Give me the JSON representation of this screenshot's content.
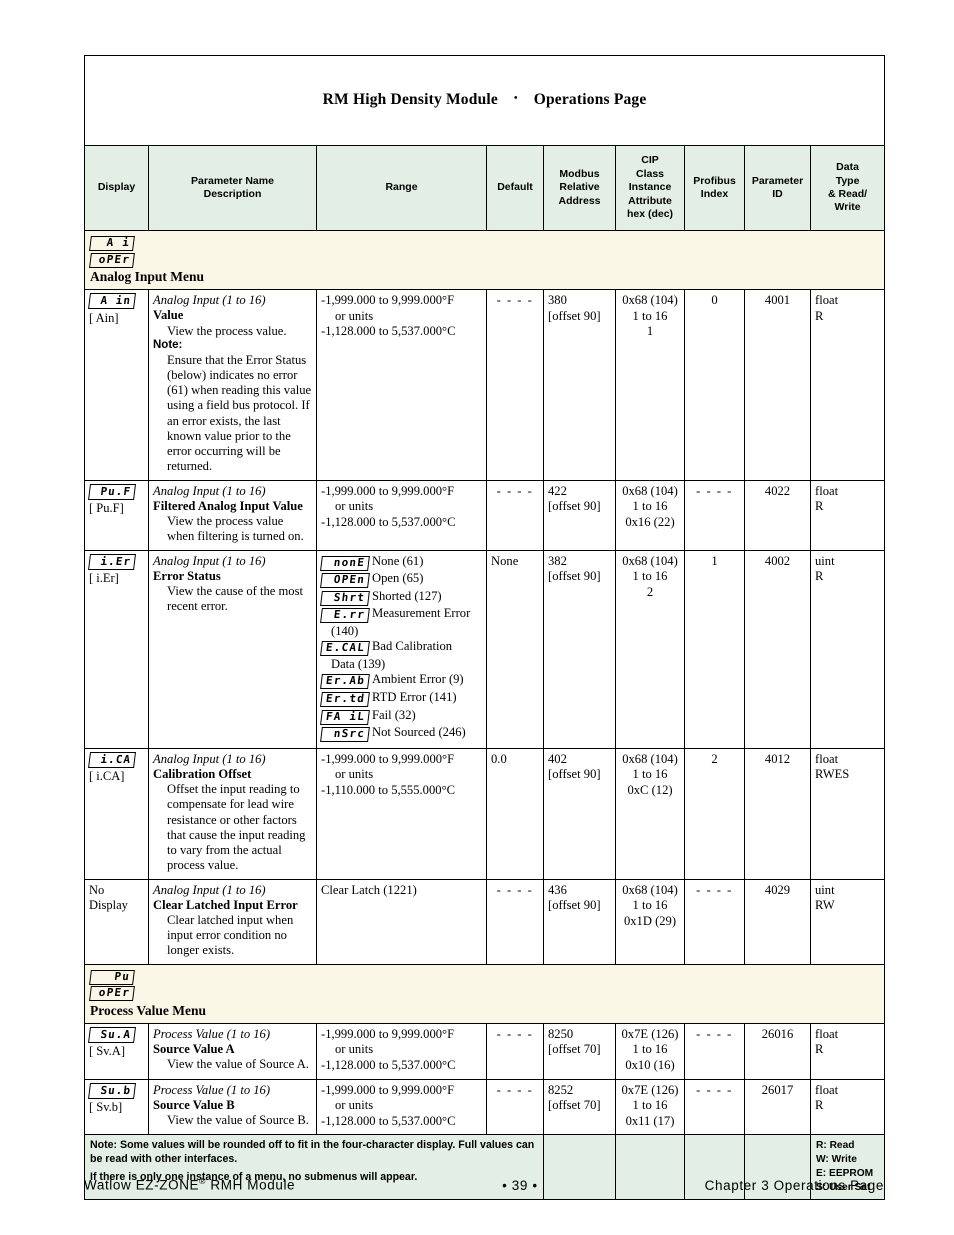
{
  "document": {
    "title_line": "RM High Density Module",
    "title_sep": "•",
    "title_line2": "Operations Page"
  },
  "columns": [
    "Display",
    "Parameter Name\nDescription",
    "Range",
    "Default",
    "Modbus\nRelative\nAddress",
    "CIP\nClass\nInstance\nAttribute\nhex (dec)",
    "Profibus\nIndex",
    "Parameter\nID",
    "Data\nType\n& Read/\nWrite"
  ],
  "column_labels": {
    "display": "Display",
    "param_name": "Parameter Name",
    "param_desc": "Description",
    "range": "Range",
    "default": "Default",
    "modbus_1": "Modbus",
    "modbus_2": "Relative",
    "modbus_3": "Address",
    "cip_1": "CIP",
    "cip_2": "Class",
    "cip_3": "Instance",
    "cip_4": "Attribute",
    "cip_5": "hex (dec)",
    "profibus_1": "Profibus",
    "profibus_2": "Index",
    "pid_1": "Parameter",
    "pid_2": "ID",
    "dtype_1": "Data",
    "dtype_2": "Type",
    "dtype_3": "& Read/",
    "dtype_4": "Write"
  },
  "menus": [
    {
      "lcd_top": "A i",
      "lcd_bottom": "oPEr",
      "title": "Analog Input Menu"
    },
    {
      "lcd_top": "Pu",
      "lcd_bottom": "oPEr",
      "title": "Process Value Menu"
    }
  ],
  "rows": [
    {
      "display_chip": "A in",
      "display_alt": "[ Ain]",
      "scope": "Analog Input (1 to 16)",
      "name": "Value",
      "desc": "View the process value.",
      "note_label": "Note:",
      "note_body": "Ensure that the Error Status (below) indicates no error (61) when reading this value using a field bus protocol. If an error exists, the last known value prior to the error occurring will be returned.",
      "range_f": "-1,999.000 to 9,999.000°F",
      "range_units": "or units",
      "range_c": "-1,128.000 to 5,537.000°C",
      "default": "- - - -",
      "modbus": "380",
      "modbus_offset": "[offset 90]",
      "cip_class": "0x68 (104)",
      "cip_instance": "1 to 16",
      "cip_attribute": "1",
      "profibus": "0",
      "param_id": "4001",
      "data_type": "float",
      "read_write": "R"
    },
    {
      "display_chip": "Pu.F",
      "display_alt": "[ Pu.F]",
      "scope": "Analog Input (1 to 16)",
      "name": "Filtered Analog Input Value",
      "desc": "View the process value when filtering is turned on.",
      "range_f": "-1,999.000 to 9,999.000°F",
      "range_units": "or units",
      "range_c": "-1,128.000 to 5,537.000°C",
      "default": "- - - -",
      "modbus": "422",
      "modbus_offset": "[offset 90]",
      "cip_class": "0x68 (104)",
      "cip_instance": "1 to 16",
      "cip_attribute": "0x16 (22)",
      "profibus": "- - - -",
      "param_id": "4022",
      "data_type": "float",
      "read_write": "R"
    },
    {
      "display_chip": "i.Er",
      "display_alt": "[ i.Er]",
      "scope": "Analog Input (1 to 16)",
      "name": "Error Status",
      "desc": "View the cause of the most recent error.",
      "enums": [
        {
          "code": "nonE",
          "label": "None (61)"
        },
        {
          "code": "OPEn",
          "label": "Open (65)"
        },
        {
          "code": "Shrt",
          "label": "Shorted (127)"
        },
        {
          "code": "E.rr",
          "label": "Measurement Error",
          "cont": "(140)"
        },
        {
          "code": "E.CAL",
          "label": "Bad Calibration",
          "cont": "Data (139)"
        },
        {
          "code": "Er.Ab",
          "label": "Ambient Error (9)"
        },
        {
          "code": "Er.td",
          "label": "RTD Error (141)"
        },
        {
          "code": "FA iL",
          "label": "Fail (32)"
        },
        {
          "code": "nSrc",
          "label": "Not Sourced (246)"
        }
      ],
      "default": "None",
      "modbus": "382",
      "modbus_offset": "[offset 90]",
      "cip_class": "0x68 (104)",
      "cip_instance": "1 to 16",
      "cip_attribute": "2",
      "profibus": "1",
      "param_id": "4002",
      "data_type": "uint",
      "read_write": "R"
    },
    {
      "display_chip": "i.CA",
      "display_alt": "[ i.CA]",
      "scope": "Analog Input (1 to 16)",
      "name": "Calibration Offset",
      "desc": "Offset the input reading to compensate for lead wire resistance or other factors that cause the input reading to vary from the actual process value.",
      "range_f": "-1,999.000 to 9,999.000°F",
      "range_units": "or units",
      "range_c": "-1,110.000 to 5,555.000°C",
      "default": "0.0",
      "modbus": "402",
      "modbus_offset": "[offset 90]",
      "cip_class": "0x68 (104)",
      "cip_instance": "1 to 16",
      "cip_attribute": "0xC (12)",
      "profibus": "2",
      "param_id": "4012",
      "data_type": "float",
      "read_write": "RWES"
    },
    {
      "display_chip": null,
      "display_text": "No Display",
      "scope": "Analog Input (1 to 16)",
      "name": "Clear Latched Input Error",
      "desc": "Clear latched input when input error condition no longer exists.",
      "range_f": "Clear Latch (1221)",
      "default": "- - - -",
      "modbus": "436",
      "modbus_offset": "[offset 90]",
      "cip_class": "0x68 (104)",
      "cip_instance": "1 to 16",
      "cip_attribute": "0x1D (29)",
      "profibus": "- - - -",
      "param_id": "4029",
      "data_type": "uint",
      "read_write": "RW"
    },
    {
      "display_chip": "Su.A",
      "display_alt": "[ Sv.A]",
      "scope": "Process Value (1 to 16)",
      "name": "Source Value A",
      "desc": "View the value of Source A.",
      "range_f": "-1,999.000 to 9,999.000°F",
      "range_units": "or units",
      "range_c": "-1,128.000 to 5,537.000°C",
      "default": "- - - -",
      "modbus": "8250",
      "modbus_offset": "[offset 70]",
      "cip_class": "0x7E (126)",
      "cip_instance": "1 to 16",
      "cip_attribute": "0x10 (16)",
      "profibus": "- - - -",
      "param_id": "26016",
      "data_type": "float",
      "read_write": "R"
    },
    {
      "display_chip": "Su.b",
      "display_alt": "[ Sv.b]",
      "scope": "Process Value (1 to 16)",
      "name": "Source Value B",
      "desc": "View the value of Source B.",
      "range_f": "-1,999.000 to 9,999.000°F",
      "range_units": "or units",
      "range_c": "-1,128.000 to 5,537.000°C",
      "default": "- - - -",
      "modbus": "8252",
      "modbus_offset": "[offset 70]",
      "cip_class": "0x7E (126)",
      "cip_instance": "1 to 16",
      "cip_attribute": "0x11 (17)",
      "profibus": "- - - -",
      "param_id": "26017",
      "data_type": "float",
      "read_write": "R"
    }
  ],
  "footer_note": {
    "line1": "Note: Some values will be rounded off to fit in the four-character display. Full values can be read with other interfaces.",
    "line2": "If there is only one instance of a menu, no submenus will appear.",
    "legend": [
      "R: Read",
      "W: Write",
      "E: EEPROM",
      "S: User Set"
    ]
  },
  "page_footer": {
    "left_pre": "Watlow EZ-ZONE",
    "left_sup": "®",
    "left_post": " RMH Module",
    "center": "•  39  •",
    "right": "Chapter 3 Operations Page"
  },
  "colors": {
    "header_bg": "#e3eee4",
    "menu_bg": "#fbf7e7",
    "border": "#000000",
    "page_bg": "#ffffff"
  }
}
